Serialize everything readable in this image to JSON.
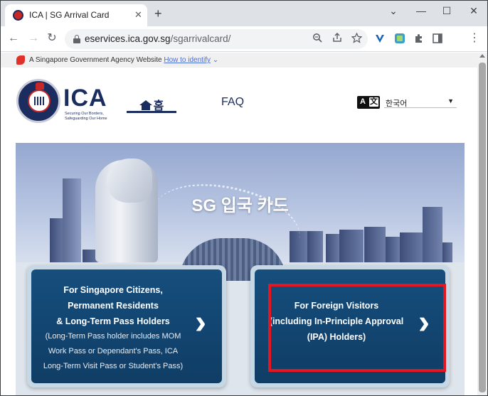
{
  "browser": {
    "tab_title": "ICA | SG Arrival Card",
    "tab_close": "✕",
    "new_tab": "+",
    "window_controls": {
      "minimize": "—",
      "maximize": "☐",
      "close": "✕",
      "expand": "⌄"
    },
    "nav": {
      "back": "←",
      "forward": "→",
      "reload": "↻"
    },
    "url_host": "eservices.ica.gov.sg",
    "url_path": "/sgarrivalcard/",
    "menu": "⋮",
    "icons": [
      "lock-icon",
      "zoom-icon",
      "share-icon",
      "star-icon",
      "extension-v-icon",
      "extension-translate-icon",
      "puzzle-icon",
      "sidepanel-icon",
      "menu-icon"
    ]
  },
  "gov_banner": {
    "text": "A Singapore Government Agency Website",
    "link": "How to identify",
    "chevron": "⌄"
  },
  "header": {
    "logo_word": "ICA",
    "logo_tagline": "Securing Our Borders, Safeguarding Our Home",
    "nav_home": "홈",
    "nav_faq": "FAQ",
    "lang_icon_left": "A",
    "lang_icon_right": "文",
    "language_selected": "한국어",
    "language_caret": "▼"
  },
  "hero": {
    "title": "SG 입국 카드"
  },
  "cards": {
    "citizens": {
      "line1": "For Singapore Citizens,",
      "line2": "Permanent Residents",
      "line3": "& Long-Term Pass Holders",
      "note1": "(Long-Term Pass holder includes MOM",
      "note2": "Work Pass or Dependant's Pass, ICA",
      "note3": "Long-Term Visit Pass or Student's Pass)",
      "chevron": "›"
    },
    "visitors": {
      "line1": "For Foreign Visitors",
      "line2": "(including In-Principle Approval",
      "line3": "(IPA) Holders)",
      "chevron": "›"
    }
  },
  "colors": {
    "brand_navy": "#1b2c5e",
    "card_blue": "#164e7d",
    "highlight_red": "#e5161f"
  }
}
